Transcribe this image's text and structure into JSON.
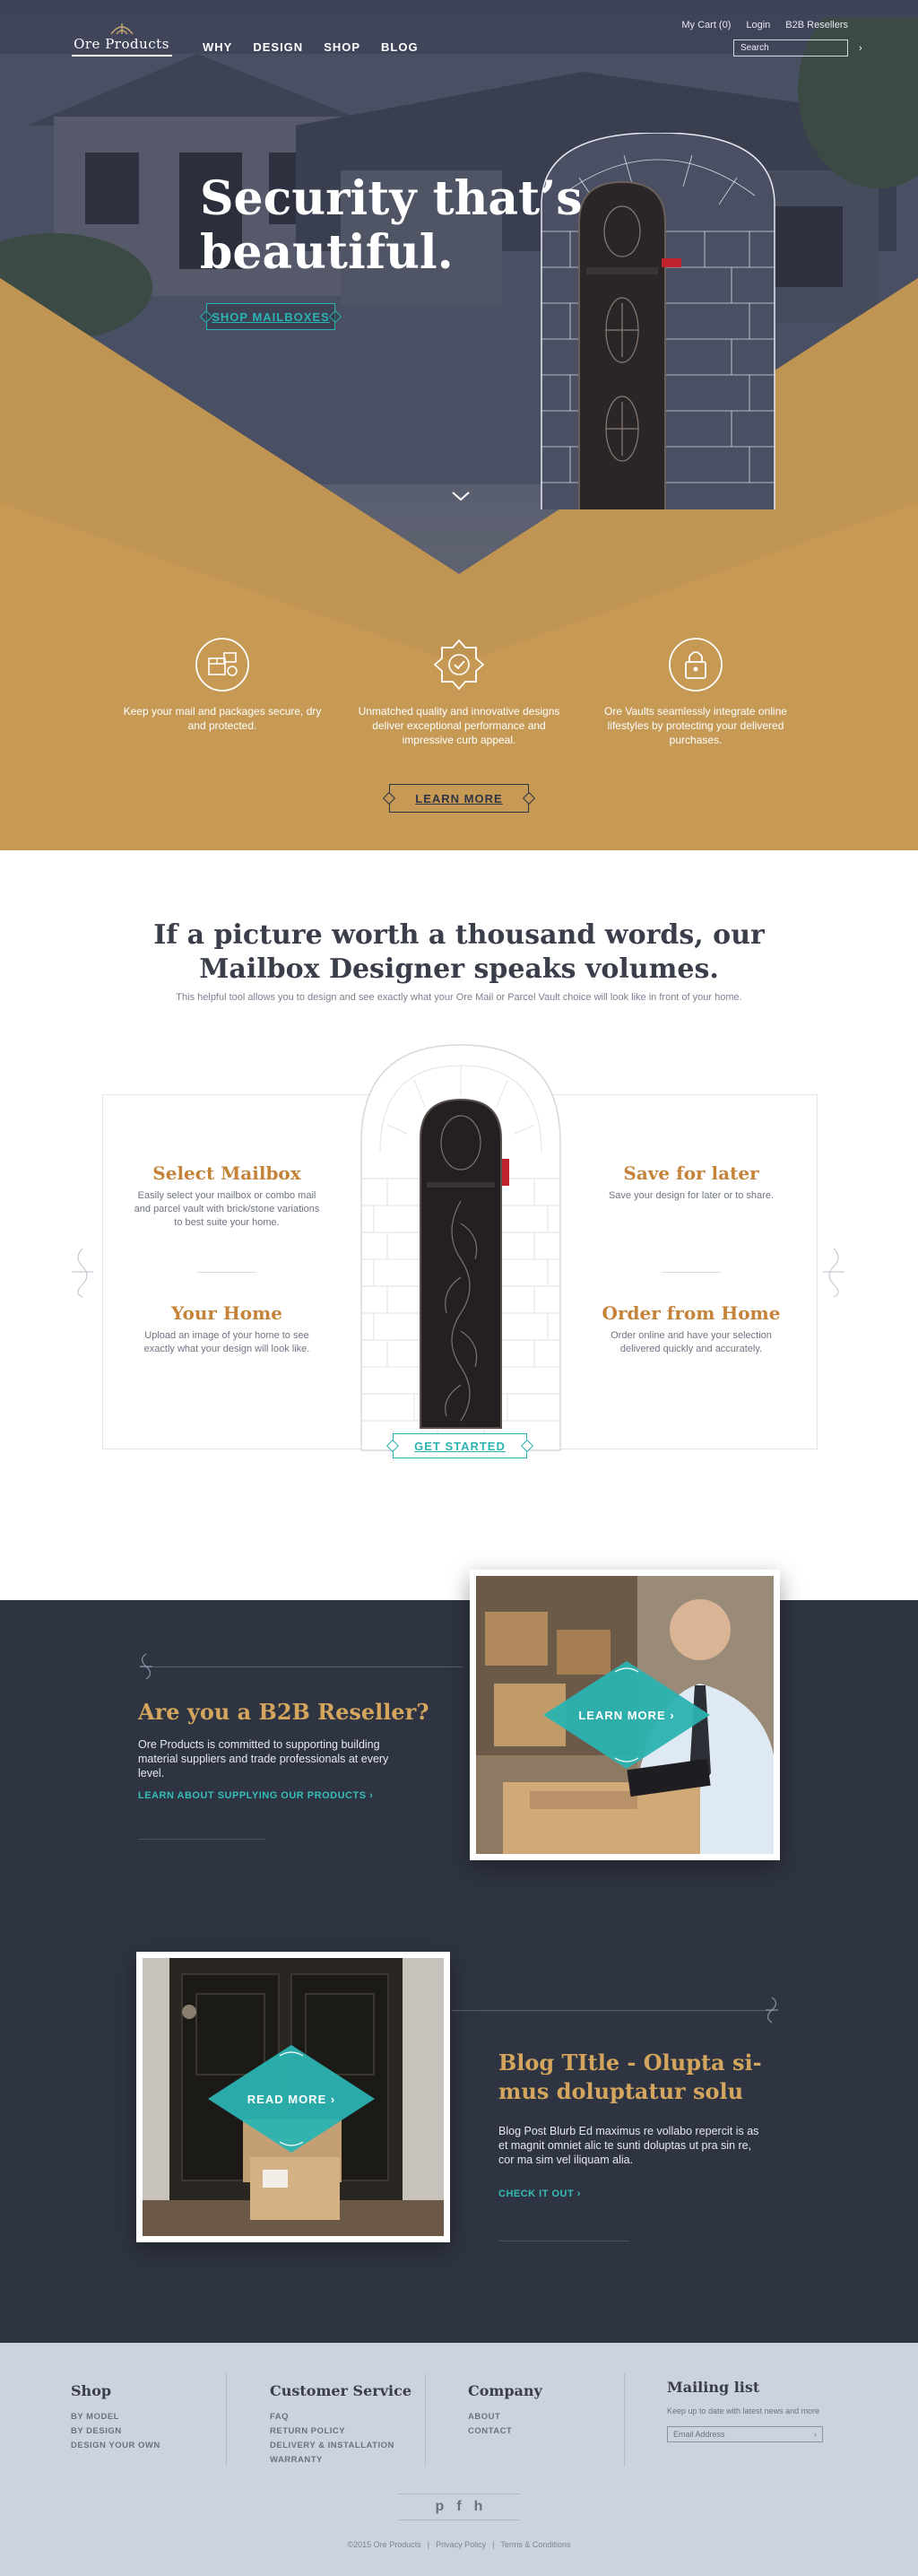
{
  "brand": {
    "name": "Ore Products"
  },
  "nav": {
    "main": [
      "WHY",
      "DESIGN",
      "SHOP",
      "BLOG"
    ],
    "cart": "My Cart (0)",
    "login": "Login",
    "b2b": "B2B Resellers",
    "search_placeholder": "Search"
  },
  "hero": {
    "title_line1": "Security that’s",
    "title_line2": "beautiful.",
    "cta": "SHOP MAILBOXES"
  },
  "features": [
    {
      "icon": "mailbox-package-icon",
      "text": "Keep your mail and packages secure, dry and protected."
    },
    {
      "icon": "quality-badge-icon",
      "text": "Unmatched quality and innovative designs deliver exceptional performance and impressive curb appeal."
    },
    {
      "icon": "lock-icon",
      "text": "Ore Vaults seamlessly integrate online lifestyles by protecting your delivered purchases."
    }
  ],
  "learn_more": "LEARN MORE",
  "designer": {
    "title_line1": "If a picture worth a thousand words, our",
    "title_line2": "Mailbox Designer speaks volumes.",
    "subtitle": "This helpful tool allows you to design and see exactly what your Ore Mail or Parcel Vault choice will look like in front of your home.",
    "steps": [
      {
        "title": "Select Mailbox",
        "text": "Easily select your mailbox or combo mail and parcel vault with brick/stone variations to best suite your home."
      },
      {
        "title": "Your Home",
        "text": "Upload an image of your home to see exactly what your design will look like."
      },
      {
        "title": "Save for later",
        "text": "Save your design for later or to share."
      },
      {
        "title": "Order from Home",
        "text": "Order online and have your selection delivered quickly and accurately."
      }
    ],
    "cta": "GET STARTED"
  },
  "b2b": {
    "title": "Are you a B2B Reseller?",
    "body": "Ore Products is committed to supporting building material suppliers and trade professionals at every level.",
    "link": "LEARN ABOUT SUPPLYING OUR PRODUCTS ›",
    "photo_cta": "LEARN MORE ›"
  },
  "blog": {
    "title_line1": "Blog TItle - Olupta si-",
    "title_line2": "mus doluptatur solu",
    "body": "Blog Post Blurb Ed maximus re vollabo repercit is as et magnit omniet alic te sunti doluptas ut pra sin re, cor ma sim vel iliquam alia.",
    "link": "CHECK IT OUT ›",
    "photo_cta": "READ MORE ›"
  },
  "footer": {
    "shop": {
      "title": "Shop",
      "links": [
        "BY MODEL",
        "BY DESIGN",
        "DESIGN YOUR OWN"
      ]
    },
    "service": {
      "title": "Customer Service",
      "links": [
        "FAQ",
        "RETURN POLICY",
        "DELIVERY & INSTALLATION",
        "WARRANTY"
      ]
    },
    "company": {
      "title": "Company",
      "links": [
        "ABOUT",
        "CONTACT"
      ]
    },
    "mailing": {
      "title": "Mailing list",
      "sub": "Keep up to date with latest news and more",
      "placeholder": "Email Address"
    },
    "social": [
      "p",
      "f",
      "h"
    ],
    "copyright": "©2015 Ore Products",
    "privacy": "Privacy Policy",
    "terms": "Terms & Conditions"
  },
  "colors": {
    "navy": "#2f3442",
    "teal": "#2bb3b1",
    "gold": "#c69a55",
    "title_gold": "#d4a55c",
    "step_orange": "#c5833a"
  }
}
